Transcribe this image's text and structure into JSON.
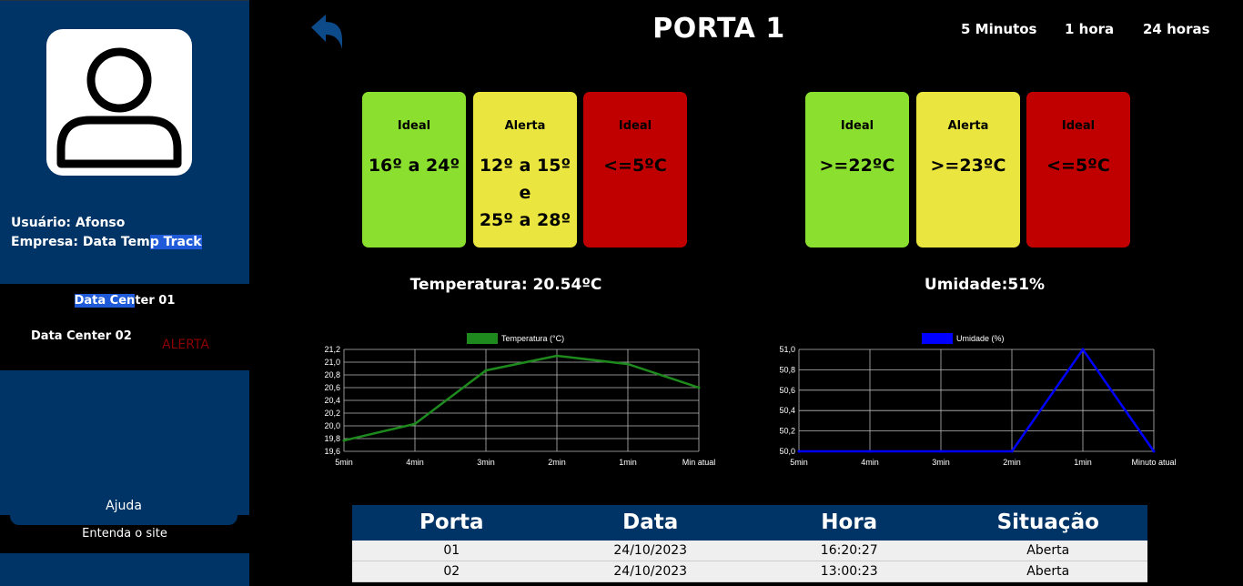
{
  "sidebar": {
    "user": "Usuário: Afonso",
    "company_prefix": "Empresa: Data Tem",
    "company_highlight": "p Track",
    "dc1_highlight": "Data Cen",
    "dc1_rest": "ter 01",
    "dc2": "Data Center 02",
    "alert": "ALERTA",
    "help": "Ajuda",
    "help_sub": "Entenda o site"
  },
  "header": {
    "title": "PORTA 1",
    "ranges": [
      "5 Minutos",
      "1 hora",
      "24 horas"
    ]
  },
  "temp_cards": [
    {
      "label": "Ideal",
      "value": "16º a 24º"
    },
    {
      "label": "Alerta",
      "value1": "12º a 15º",
      "value2": "e",
      "value3": "25º a 28º"
    },
    {
      "label": "Ideal",
      "value": "<=5ºC"
    }
  ],
  "hum_cards": [
    {
      "label": "Ideal",
      "value": ">=22ºC"
    },
    {
      "label": "Alerta",
      "value": ">=23ºC"
    },
    {
      "label": "Ideal",
      "value": "<=5ºC"
    }
  ],
  "readings": {
    "temperature": "Temperatura: 20.54ºC",
    "humidity": "Umidade:51%"
  },
  "chart_data": [
    {
      "type": "line",
      "categories": [
        "5min",
        "4min",
        "3min",
        "2min",
        "1min",
        "Min atual"
      ],
      "series": [
        {
          "name": "Temperatura (°C)",
          "values": [
            19.77,
            20.03,
            20.87,
            21.1,
            20.97,
            20.6
          ],
          "color": "#1e8a1e"
        }
      ],
      "ylim": [
        19.6,
        21.2
      ],
      "yticks": [
        "19,6",
        "19,8",
        "20,0",
        "20,2",
        "20,4",
        "20,6",
        "20,8",
        "21,0",
        "21,2"
      ],
      "grid": true,
      "legend": "top"
    },
    {
      "type": "line",
      "categories": [
        "5min",
        "4min",
        "3min",
        "2min",
        "1min",
        "Minuto atual"
      ],
      "series": [
        {
          "name": "Umidade (%)",
          "values": [
            50,
            50,
            50,
            50,
            51,
            50
          ],
          "color": "#0000ff"
        }
      ],
      "ylim": [
        50,
        51
      ],
      "yticks": [
        "50,0",
        "50,2",
        "50,4",
        "50,6",
        "50,8",
        "51,0"
      ],
      "grid": true,
      "legend": "top"
    }
  ],
  "table": {
    "headers": [
      "Porta",
      "Data",
      "Hora",
      "Situação"
    ],
    "rows": [
      [
        "01",
        "24/10/2023",
        "16:20:27",
        "Aberta"
      ],
      [
        "02",
        "24/10/2023",
        "13:00:23",
        "Aberta"
      ]
    ]
  }
}
